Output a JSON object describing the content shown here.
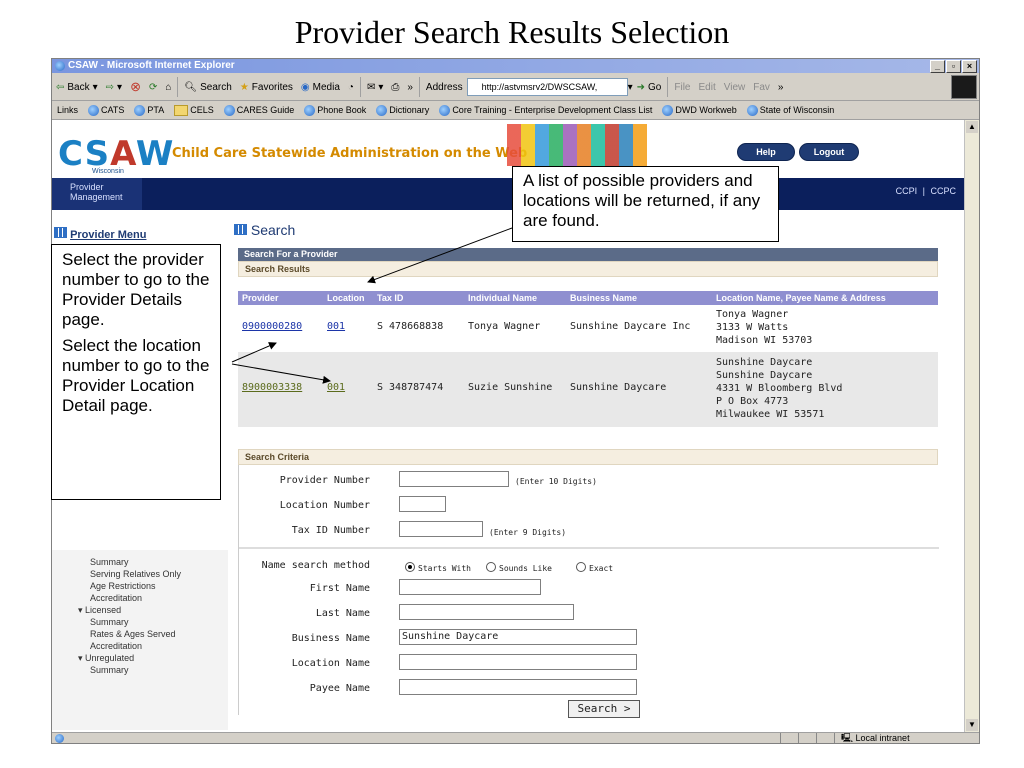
{
  "slide_title": "Provider Search Results Selection",
  "window": {
    "title": "CSAW - Microsoft Internet Explorer",
    "controls": [
      "_",
      "ő",
      "x"
    ]
  },
  "toolbar": {
    "back": "Back",
    "search": "Search",
    "favorites": "Favorites",
    "media": "Media",
    "more": "»",
    "address_label": "Address",
    "address_value": "http://astvmsrv2/DWSCSAW,",
    "go": "Go",
    "file": "File",
    "edit": "Edit",
    "view": "View",
    "fav": "Fav",
    "more2": "»"
  },
  "links_bar": {
    "label": "Links",
    "items": [
      "CATS",
      "PTA",
      "CELS",
      "CARES Guide",
      "Phone Book",
      "Dictionary",
      "Core Training - Enterprise Development Class List",
      "DWD Workweb",
      "State of Wisconsin"
    ]
  },
  "header": {
    "logo": "CSAW",
    "logo_sub": "Wisconsin",
    "tagline": "Child Care Statewide Administration on the Web",
    "help": "Help",
    "logout": "Logout",
    "nav_left_line1": "Provider",
    "nav_left_line2": "Management",
    "nav_right_1": "CCPI",
    "nav_right_sep": "|",
    "nav_right_2": "CCPC"
  },
  "provider_menu": "Provider Menu",
  "left_menu": [
    "Summary",
    "Serving Relatives Only",
    "Age Restrictions",
    "Accreditation",
    "Licensed",
    "Summary",
    "Rates & Ages Served",
    "Accreditation",
    "Unregulated",
    "Summary"
  ],
  "search": {
    "title": "Search",
    "panel_header": "Search For a Provider",
    "results_header": "Search Results",
    "columns": [
      "Provider",
      "Location",
      "Tax ID",
      "Individual Name",
      "Business Name",
      "Location Name, Payee Name & Address"
    ],
    "rows": [
      {
        "provider": "0900000280",
        "location": "001",
        "tax_id": "S 478668838",
        "individual": "Tonya Wagner",
        "business": "Sunshine Daycare Inc",
        "address": [
          "Tonya Wagner",
          "3133 W Watts",
          "Madison WI 53703"
        ]
      },
      {
        "provider": "8900003338",
        "location": "001",
        "tax_id": "S 348787474",
        "individual": "Suzie Sunshine",
        "business": "Sunshine Daycare",
        "address": [
          "Sunshine Daycare",
          "Sunshine Daycare",
          "4331 W Bloomberg Blvd",
          "P O Box 4773",
          "Milwaukee WI 53571"
        ]
      }
    ],
    "criteria_header": "Search Criteria",
    "provider_number_label": "Provider Number",
    "provider_number_hint": "(Enter 10 Digits)",
    "provider_number_value": "",
    "location_number_label": "Location Number",
    "location_number_value": "",
    "tax_id_label": "Tax ID Number",
    "tax_id_hint": "(Enter 9 Digits)",
    "tax_id_value": "",
    "name_method_label": "Name search method",
    "name_methods": [
      "Starts With",
      "Sounds Like",
      "Exact"
    ],
    "selected_method": "Starts With",
    "first_name_label": "First Name",
    "first_name_value": "",
    "last_name_label": "Last Name",
    "last_name_value": "",
    "business_name_label": "Business Name",
    "business_name_value": "Sunshine Daycare",
    "location_name_label": "Location Name",
    "location_name_value": "",
    "payee_name_label": "Payee Name",
    "payee_name_value": "",
    "search_button": "Search >"
  },
  "status_bar": {
    "zone": "Local intranet"
  },
  "callouts": {
    "top_right": "A list of possible providers and locations will be returned, if any are found.",
    "left_1": "Select the provider number to go to the Provider Details page.",
    "left_2": "Select the location number to go to the Provider Location Detail page."
  }
}
